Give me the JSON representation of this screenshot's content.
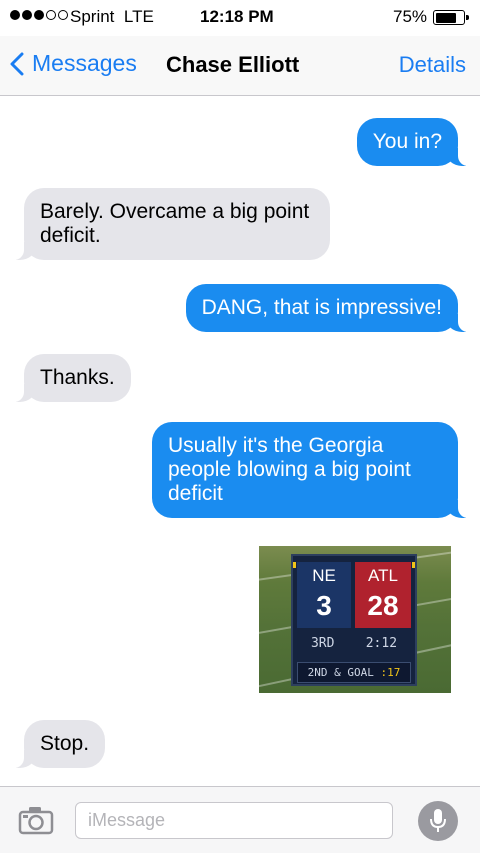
{
  "status_bar": {
    "carrier": "Sprint",
    "network": "LTE",
    "time": "12:18 PM",
    "battery_percent": "75%",
    "signal_bars_filled": 3,
    "signal_bars_total": 5,
    "battery_level": 0.75
  },
  "nav": {
    "back_label": "Messages",
    "contact_name": "Chase Elliott",
    "details_label": "Details"
  },
  "messages": [
    {
      "direction": "out",
      "text": "You in?"
    },
    {
      "direction": "in",
      "text": "Barely. Overcame a big point deficit."
    },
    {
      "direction": "out",
      "text": "DANG, that is impressive!"
    },
    {
      "direction": "in",
      "text": "Thanks."
    },
    {
      "direction": "out",
      "text": "Usually it's the Georgia people blowing a big point deficit"
    },
    {
      "direction": "out",
      "type": "image"
    },
    {
      "direction": "in",
      "text": "Stop."
    }
  ],
  "scoreboard": {
    "team1": "NE",
    "score1": "3",
    "team2": "ATL",
    "score2": "28",
    "quarter": "3RD",
    "clock": "2:12",
    "down": "2ND & GOAL",
    "play_clock": ":17"
  },
  "input": {
    "placeholder": "iMessage"
  },
  "colors": {
    "accent": "#1a7df2",
    "outgoing_bubble": "#1a8cf0",
    "incoming_bubble": "#e5e5ea"
  }
}
